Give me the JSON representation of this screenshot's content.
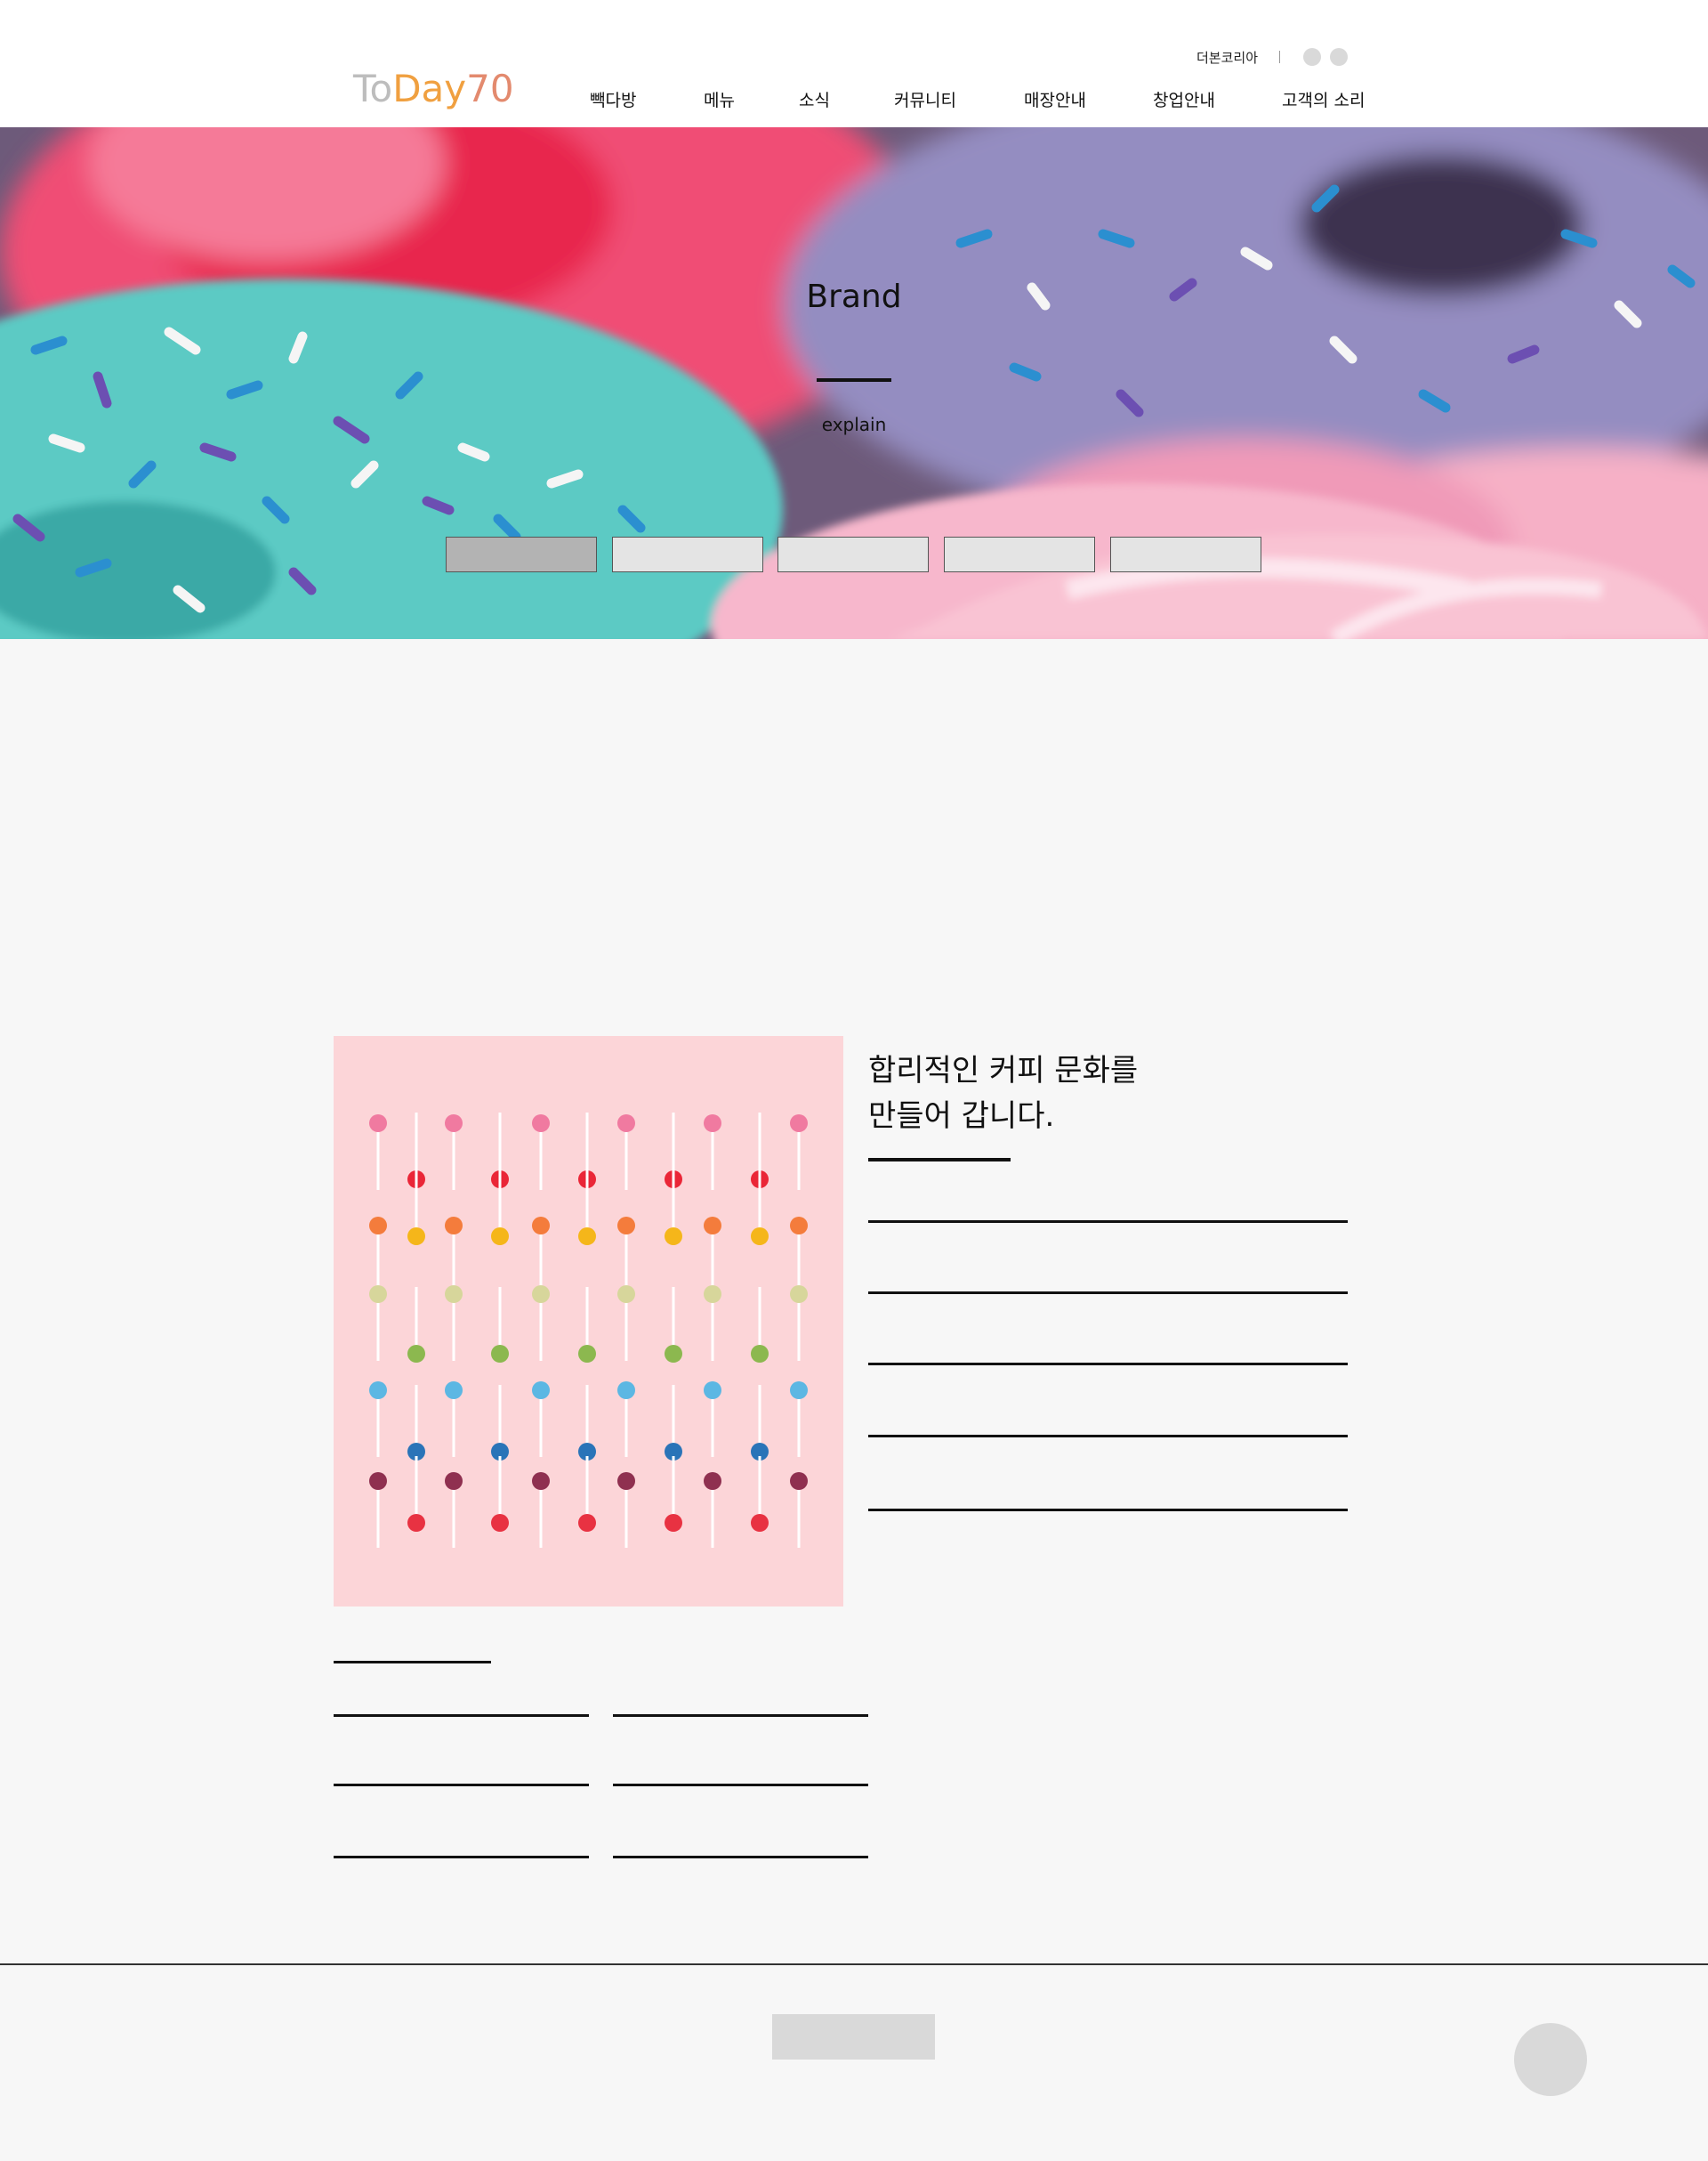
{
  "header": {
    "logo": {
      "part1": "To",
      "part2": "Day",
      "part3": "70"
    },
    "util_link": "더본코리아",
    "nav": [
      "빽다방",
      "메뉴",
      "소식",
      "커뮤니티",
      "매장안내",
      "창업안내",
      "고객의 소리"
    ]
  },
  "hero": {
    "title": "Brand",
    "subtitle": "explain",
    "tab_count": 5,
    "active_tab": 0
  },
  "content": {
    "heading_line1": "합리적인 커피 문화를",
    "heading_line2": "만들어 갑니다."
  },
  "colors": {
    "page_bg": "#f7f7f7",
    "logo_to": "#bdbdbd",
    "logo_day": "#f0a040",
    "logo_70": "#e38a6e",
    "image_bg": "#fcd5d8"
  }
}
